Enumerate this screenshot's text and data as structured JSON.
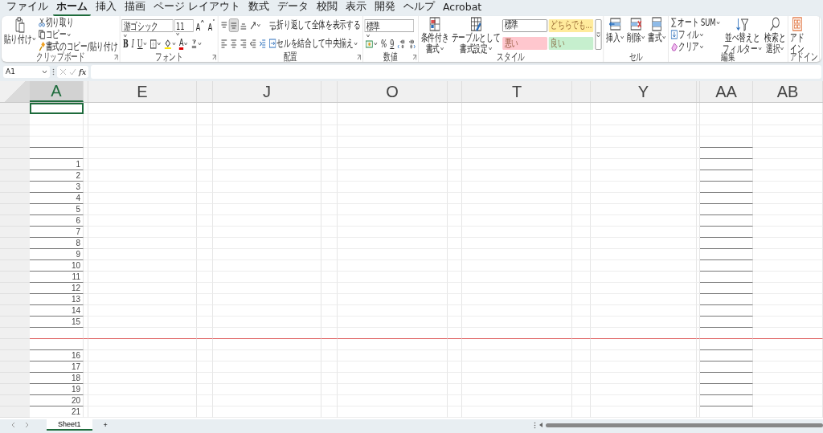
{
  "menu_tabs": [
    {
      "label": "ファイル",
      "selected": false
    },
    {
      "label": "ホーム",
      "selected": true
    },
    {
      "label": "挿入",
      "selected": false
    },
    {
      "label": "描画",
      "selected": false
    },
    {
      "label": "ページ レイアウト",
      "selected": false
    },
    {
      "label": "数式",
      "selected": false
    },
    {
      "label": "データ",
      "selected": false
    },
    {
      "label": "校閲",
      "selected": false
    },
    {
      "label": "表示",
      "selected": false
    },
    {
      "label": "開発",
      "selected": false
    },
    {
      "label": "ヘルプ",
      "selected": false
    },
    {
      "label": "Acrobat",
      "selected": false
    }
  ],
  "ribbon_groups": [
    {
      "name": "クリップボード",
      "launcher": true,
      "columns": [
        {
          "rows": [
            {
              "items": [
                {
                  "kind": "big",
                  "lines": [
                    "貼り付け"
                  ],
                  "menu": true
                }
              ]
            }
          ]
        },
        {
          "rows": [
            {
              "items": [
                {
                  "kind": "small",
                  "label": "切り取り",
                  "menu": false
                }
              ]
            },
            {
              "items": [
                {
                  "kind": "small",
                  "label": "コピー",
                  "menu": true
                }
              ]
            },
            {
              "items": [
                {
                  "kind": "small",
                  "label": "書式のコピー/貼り付け",
                  "menu": false
                }
              ]
            }
          ]
        }
      ]
    },
    {
      "name": "フォント",
      "launcher": true,
      "columns": [
        {
          "rows": [
            {
              "items": [
                {
                  "kind": "field",
                  "value": "游ゴシック"
                },
                {
                  "kind": "field",
                  "value": "11"
                },
                {
                  "kind": "glyph",
                  "label": "A$^{^}$",
                  "on": false,
                  "menu": false
                },
                {
                  "kind": "glyph",
                  "label": "A$^{ˇ}$",
                  "on": false,
                  "menu": false
                }
              ]
            },
            {
              "items": [
                {
                  "kind": "glyph",
                  "label": "B",
                  "on": false,
                  "menu": false
                },
                {
                  "kind": "glyph",
                  "label": "I",
                  "on": false,
                  "menu": false
                },
                {
                  "kind": "glyph",
                  "label": "U",
                  "on": false,
                  "menu": true
                },
                {
                  "kind": "tool",
                  "on": false,
                  "menu": true
                },
                {
                  "kind": "tool",
                  "on": false,
                  "menu": true
                },
                {
                  "kind": "glyph",
                  "label": "A",
                  "on": false,
                  "menu": true
                },
                {
                  "kind": "tool",
                  "on": false,
                  "menu": true
                }
              ]
            }
          ]
        }
      ]
    },
    {
      "name": "配置",
      "launcher": true,
      "columns": [
        {
          "rows": [
            {
              "items": [
                {
                  "kind": "tool",
                  "on": false,
                  "menu": false
                },
                {
                  "kind": "tool",
                  "on": true,
                  "menu": false
                },
                {
                  "kind": "tool",
                  "on": false,
                  "menu": false
                },
                {
                  "kind": "tool",
                  "on": false,
                  "menu": true
                }
              ]
            },
            {
              "items": [
                {
                  "kind": "tool",
                  "on": false,
                  "menu": false
                },
                {
                  "kind": "tool",
                  "on": false,
                  "menu": false
                },
                {
                  "kind": "tool",
                  "on": false,
                  "menu": false
                },
                {
                  "kind": "tool",
                  "on": false,
                  "menu": false
                },
                {
                  "kind": "tool",
                  "on": false,
                  "menu": false
                }
              ]
            }
          ]
        },
        {
          "rows": [
            {
              "items": [
                {
                  "kind": "small",
                  "label": "折り返して全体を表示する",
                  "menu": false
                }
              ]
            },
            {
              "items": [
                {
                  "kind": "small",
                  "label": "セルを結合して中央揃え",
                  "menu": true
                }
              ]
            }
          ]
        }
      ]
    },
    {
      "name": "数値",
      "launcher": true,
      "columns": [
        {
          "rows": [
            {
              "items": [
                {
                  "kind": "field",
                  "value": "標準"
                }
              ]
            },
            {
              "items": [
                {
                  "kind": "tool",
                  "on": false,
                  "menu": true
                },
                {
                  "kind": "glyph",
                  "label": "%",
                  "on": false,
                  "menu": false
                },
                {
                  "kind": "glyph",
                  "label": "9",
                  "on": false,
                  "menu": false
                },
                {
                  "kind": "tool",
                  "on": false,
                  "menu": false
                },
                {
                  "kind": "tool",
                  "on": false,
                  "menu": false
                }
              ]
            }
          ]
        }
      ]
    },
    {
      "name": "スタイル",
      "launcher": false,
      "columns": [
        {
          "rows": [
            {
              "items": [
                {
                  "kind": "big",
                  "lines": [
                    "条件付き",
                    "書式"
                  ],
                  "menu": true
                }
              ]
            }
          ]
        },
        {
          "rows": [
            {
              "items": [
                {
                  "kind": "big",
                  "lines": [
                    "テーブルとして",
                    "書式設定"
                  ],
                  "menu": true
                }
              ]
            }
          ]
        },
        {
          "rows": [
            {
              "items": [
                {
                  "kind": "chip",
                  "label": "標準",
                  "color": "#ffffff"
                },
                {
                  "kind": "chip",
                  "label": "どちらでも...",
                  "color": "#ffeb9c"
                }
              ]
            },
            {
              "items": [
                {
                  "kind": "chip",
                  "label": "悪い",
                  "color": "#ffc7ce"
                },
                {
                  "kind": "chip",
                  "label": "良い",
                  "color": "#c6efce"
                }
              ]
            }
          ]
        },
        {
          "rows": [
            {
              "items": [
                {
                  "kind": "more"
                }
              ]
            }
          ]
        }
      ]
    },
    {
      "name": "セル",
      "launcher": false,
      "columns": [
        {
          "rows": [
            {
              "items": [
                {
                  "kind": "big",
                  "lines": [
                    "挿入"
                  ],
                  "menu": true
                }
              ]
            }
          ]
        },
        {
          "rows": [
            {
              "items": [
                {
                  "kind": "big",
                  "lines": [
                    "削除"
                  ],
                  "menu": true
                }
              ]
            }
          ]
        },
        {
          "rows": [
            {
              "items": [
                {
                  "kind": "big",
                  "lines": [
                    "書式"
                  ],
                  "menu": true
                }
              ]
            }
          ]
        }
      ]
    },
    {
      "name": "編集",
      "launcher": false,
      "columns": [
        {
          "rows": [
            {
              "items": [
                {
                  "kind": "small",
                  "label": "オート SUM",
                  "menu": true
                }
              ]
            },
            {
              "items": [
                {
                  "kind": "small",
                  "label": "フィル",
                  "menu": true
                }
              ]
            },
            {
              "items": [
                {
                  "kind": "small",
                  "label": "クリア",
                  "menu": true
                }
              ]
            }
          ]
        },
        {
          "rows": [
            {
              "items": [
                {
                  "kind": "big",
                  "lines": [
                    "並べ替えと",
                    "フィルター"
                  ],
                  "menu": true
                }
              ]
            }
          ]
        },
        {
          "rows": [
            {
              "items": [
                {
                  "kind": "big",
                  "lines": [
                    "検索と",
                    "選択"
                  ],
                  "menu": true
                }
              ]
            }
          ]
        }
      ]
    },
    {
      "name": "アドイン",
      "launcher": false,
      "columns": [
        {
          "rows": [
            {
              "items": [
                {
                  "kind": "big",
                  "lines": [
                    "アド",
                    "イン"
                  ],
                  "menu": false
                }
              ]
            }
          ]
        }
      ]
    }
  ],
  "formula_bar": {
    "name_box": "A1",
    "function_label": "fx"
  },
  "grid": {
    "columns": [
      {
        "kind": "normal",
        "label": "A",
        "selected": true
      },
      {
        "kind": "narrow",
        "selected": false
      },
      {
        "kind": "normal",
        "label": "E",
        "selected": false
      },
      {
        "kind": "narrow",
        "selected": false
      },
      {
        "kind": "normal",
        "label": "J",
        "selected": false
      },
      {
        "kind": "narrow",
        "selected": false
      },
      {
        "kind": "normal",
        "label": "O",
        "selected": false
      },
      {
        "kind": "narrow",
        "selected": false
      },
      {
        "kind": "normal",
        "label": "T",
        "selected": false
      },
      {
        "kind": "narrow",
        "selected": false
      },
      {
        "kind": "normal",
        "label": "Y",
        "selected": false
      },
      {
        "kind": "narrow",
        "selected": false
      },
      {
        "kind": "normal",
        "label": "AA",
        "selected": false
      },
      {
        "kind": "normal",
        "label": "AB",
        "selected": false
      }
    ],
    "rows": [
      {
        "bottom_border": false
      },
      {
        "bottom_border": false
      },
      {
        "bottom_border": false
      },
      {
        "bottom_border": true
      },
      {
        "bottom_border": true
      },
      {
        "value": "1",
        "bottom_border": true
      },
      {
        "value": "2",
        "bottom_border": true
      },
      {
        "value": "3",
        "bottom_border": true
      },
      {
        "value": "4",
        "bottom_border": true
      },
      {
        "value": "5",
        "bottom_border": true
      },
      {
        "value": "6",
        "bottom_border": true
      },
      {
        "value": "7",
        "bottom_border": true
      },
      {
        "value": "8",
        "bottom_border": true
      },
      {
        "value": "9",
        "bottom_border": true
      },
      {
        "value": "10",
        "bottom_border": true
      },
      {
        "value": "11",
        "bottom_border": true
      },
      {
        "value": "12",
        "bottom_border": true
      },
      {
        "value": "13",
        "bottom_border": true
      },
      {
        "value": "14",
        "bottom_border": true
      },
      {
        "value": "15",
        "bottom_border": true
      },
      {
        "bottom_border": false,
        "color": "#e06666"
      },
      {
        "bottom_border": true
      },
      {
        "value": "16",
        "bottom_border": true
      },
      {
        "value": "17",
        "bottom_border": true
      },
      {
        "value": "18",
        "bottom_border": true
      },
      {
        "value": "19",
        "bottom_border": true
      },
      {
        "value": "20",
        "bottom_border": true
      },
      {
        "value": "21",
        "bottom_border": false
      }
    ]
  },
  "sheet_tabs": [
    {
      "label": "Sheet1",
      "selected": true
    }
  ],
  "add_sheet": "+"
}
